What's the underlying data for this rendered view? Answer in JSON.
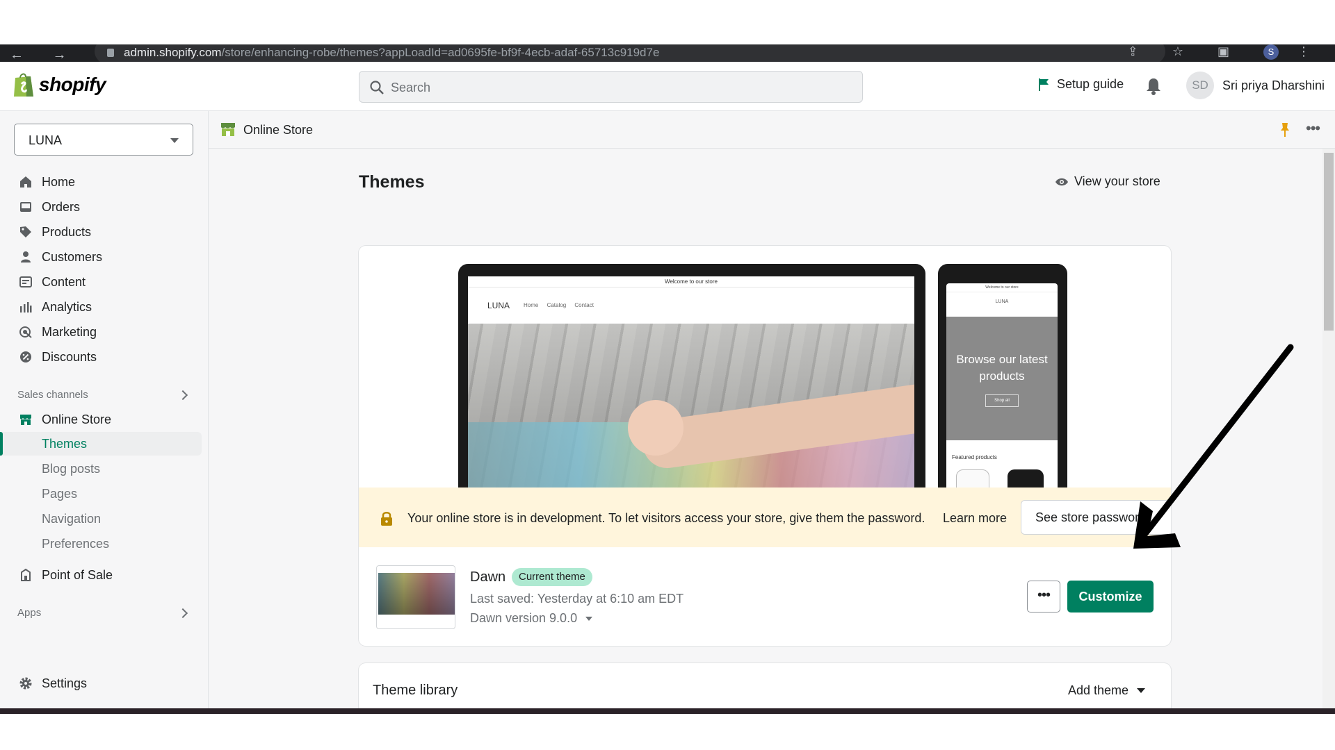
{
  "browser": {
    "url_host": "admin.shopify.com",
    "url_path": "/store/enhancing-robe/themes?appLoadId=ad0695fe-bf9f-4ecb-adaf-65713c919d7e",
    "profile_initial": "S"
  },
  "topbar": {
    "brand": "shopify",
    "search_placeholder": "Search",
    "setup_guide": "Setup guide",
    "user_initials": "SD",
    "user_name": "Sri priya Dharshini"
  },
  "sidebar": {
    "store_name": "LUNA",
    "items": [
      {
        "label": "Home",
        "icon": "home-icon"
      },
      {
        "label": "Orders",
        "icon": "orders-icon"
      },
      {
        "label": "Products",
        "icon": "tag-icon"
      },
      {
        "label": "Customers",
        "icon": "person-icon"
      },
      {
        "label": "Content",
        "icon": "content-icon"
      },
      {
        "label": "Analytics",
        "icon": "bar-chart-icon"
      },
      {
        "label": "Marketing",
        "icon": "target-icon"
      },
      {
        "label": "Discounts",
        "icon": "discount-icon"
      }
    ],
    "sales_channels_label": "Sales channels",
    "online_store": "Online Store",
    "online_store_sub": [
      "Themes",
      "Blog posts",
      "Pages",
      "Navigation",
      "Preferences"
    ],
    "active_sub": "Themes",
    "point_of_sale": "Point of Sale",
    "apps_label": "Apps",
    "settings": "Settings"
  },
  "breadcrumb": {
    "title": "Online Store"
  },
  "page": {
    "title": "Themes",
    "view_store": "View your store"
  },
  "preview": {
    "desktop_announcement": "Welcome to our store",
    "desktop_brand": "LUNA",
    "desktop_links": [
      "Home",
      "Catalog",
      "Contact"
    ],
    "mobile_announcement": "Welcome to our store",
    "mobile_brand": "LUNA",
    "mobile_hero": "Browse our latest products",
    "mobile_button": "Shop all",
    "mobile_featured": "Featured products"
  },
  "banner": {
    "message": "Your online store is in development. To let visitors access your store, give them the password.",
    "learn_more": "Learn more",
    "button": "See store password"
  },
  "current_theme": {
    "name": "Dawn",
    "badge": "Current theme",
    "last_saved": "Last saved: Yesterday at 6:10 am EDT",
    "version": "Dawn version 9.0.0",
    "more_label": "•••",
    "customize": "Customize"
  },
  "library": {
    "title": "Theme library",
    "add_theme": "Add theme"
  },
  "colors": {
    "accent": "#008060",
    "banner_bg": "#fff5dc",
    "badge_bg": "#aee9d1"
  }
}
